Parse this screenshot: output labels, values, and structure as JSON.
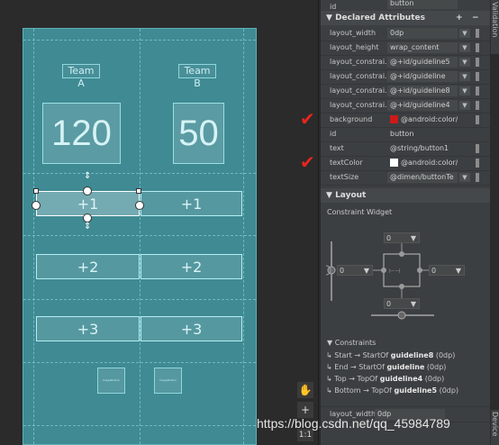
{
  "design": {
    "team_a": "Team A",
    "team_b": "Team B",
    "score_a": "120",
    "score_b": "50",
    "btn_plus1": "+1",
    "btn_plus2": "+2",
    "btn_plus3": "+3",
    "img_label": "imageButton"
  },
  "toolbar": {
    "pan": "✋",
    "zoom_in": "+",
    "ratio": "1:1"
  },
  "attrs": {
    "top_id_label": "id",
    "top_id_value": "button",
    "declared_title": "Declared Attributes",
    "add": "+",
    "remove": "−",
    "rows": [
      {
        "label": "layout_width",
        "value": "0dp"
      },
      {
        "label": "layout_height",
        "value": "wrap_content"
      },
      {
        "label": "layout_constrai...",
        "value": "@+id/guideline5"
      },
      {
        "label": "layout_constrai...",
        "value": "@+id/guideline"
      },
      {
        "label": "layout_constrai...",
        "value": "@+id/guideline8"
      },
      {
        "label": "layout_constrai...",
        "value": "@+id/guideline4"
      },
      {
        "label": "background",
        "value": "@android:color/hol"
      },
      {
        "label": "id",
        "value": "button"
      },
      {
        "label": "text",
        "value": "@string/button1"
      },
      {
        "label": "textColor",
        "value": "@android:color/whi"
      },
      {
        "label": "textSize",
        "value": "@dimen/buttonTe"
      }
    ],
    "bg_color": "#cc1a1a",
    "textcolor_color": "#ffffff"
  },
  "layout": {
    "title": "Layout",
    "cw_title": "Constraint Widget",
    "top_margin": "0",
    "left_margin": "0",
    "right_margin": "0",
    "bottom_margin": "0"
  },
  "constraints": {
    "title": "Constraints",
    "items": [
      {
        "pre": "Start → StartOf ",
        "target": "guideline8",
        "post": " (0dp)"
      },
      {
        "pre": "End → StartOf ",
        "target": "guideline",
        "post": " (0dp)"
      },
      {
        "pre": "Top → TopOf ",
        "target": "guideline4",
        "post": " (0dp)"
      },
      {
        "pre": "Bottom → TopOf ",
        "target": "guideline5",
        "post": " (0dp)"
      }
    ],
    "bottom_label": "layout_width",
    "bottom_value": "0dp"
  },
  "side_tabs": {
    "top": "Validation",
    "bottom": "Device"
  },
  "watermark": "https://blog.csdn.net/qq_45984789"
}
